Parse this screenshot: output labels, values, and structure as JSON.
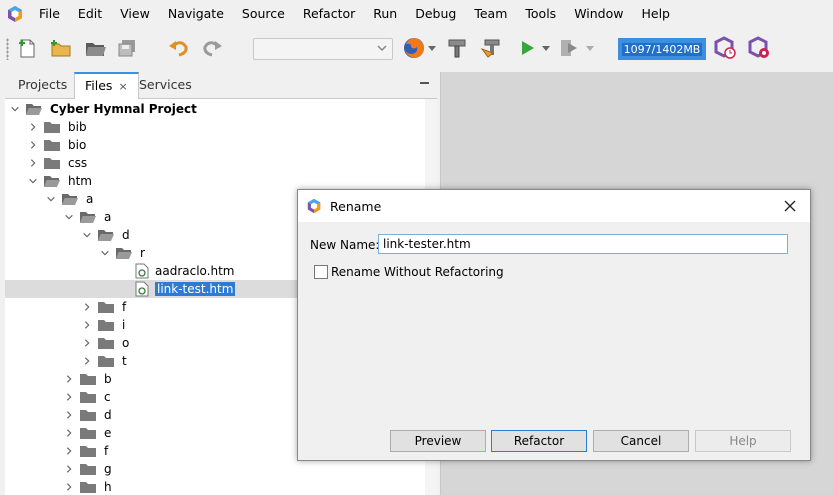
{
  "menu": [
    "File",
    "Edit",
    "View",
    "Navigate",
    "Source",
    "Refactor",
    "Run",
    "Debug",
    "Team",
    "Tools",
    "Window",
    "Help"
  ],
  "memory": {
    "label": "1097/1402MB"
  },
  "tabs": [
    {
      "label": "Projects"
    },
    {
      "label": "Files",
      "close": "×"
    },
    {
      "label": "Services"
    }
  ],
  "tree": [
    {
      "label": "Cyber Hymnal Project",
      "depth": 0,
      "expanded": true,
      "type": "root"
    },
    {
      "label": "bib",
      "depth": 1,
      "expanded": false,
      "type": "folder"
    },
    {
      "label": "bio",
      "depth": 1,
      "expanded": false,
      "type": "folder"
    },
    {
      "label": "css",
      "depth": 1,
      "expanded": false,
      "type": "folder"
    },
    {
      "label": "htm",
      "depth": 1,
      "expanded": true,
      "type": "folder"
    },
    {
      "label": "a",
      "depth": 2,
      "expanded": true,
      "type": "folder"
    },
    {
      "label": "a",
      "depth": 3,
      "expanded": true,
      "type": "folder"
    },
    {
      "label": "d",
      "depth": 4,
      "expanded": true,
      "type": "folder"
    },
    {
      "label": "r",
      "depth": 5,
      "expanded": true,
      "type": "folder"
    },
    {
      "label": "aadraclo.htm",
      "depth": 6,
      "type": "file"
    },
    {
      "label": "link-test.htm",
      "depth": 6,
      "type": "file",
      "selected": true
    },
    {
      "label": "f",
      "depth": 4,
      "expanded": false,
      "type": "folder"
    },
    {
      "label": "i",
      "depth": 4,
      "expanded": false,
      "type": "folder"
    },
    {
      "label": "o",
      "depth": 4,
      "expanded": false,
      "type": "folder"
    },
    {
      "label": "t",
      "depth": 4,
      "expanded": false,
      "type": "folder"
    },
    {
      "label": "b",
      "depth": 3,
      "expanded": false,
      "type": "folder"
    },
    {
      "label": "c",
      "depth": 3,
      "expanded": false,
      "type": "folder"
    },
    {
      "label": "d",
      "depth": 3,
      "expanded": false,
      "type": "folder"
    },
    {
      "label": "e",
      "depth": 3,
      "expanded": false,
      "type": "folder"
    },
    {
      "label": "f",
      "depth": 3,
      "expanded": false,
      "type": "folder"
    },
    {
      "label": "g",
      "depth": 3,
      "expanded": false,
      "type": "folder"
    },
    {
      "label": "h",
      "depth": 3,
      "expanded": false,
      "type": "folder"
    }
  ],
  "dialog": {
    "title": "Rename",
    "new_name_label": "New Name:",
    "new_name_value": "link-tester.htm",
    "checkbox_label": "Rename Without Refactoring",
    "buttons": {
      "preview": "Preview",
      "refactor": "Refactor",
      "cancel": "Cancel",
      "help": "Help"
    }
  },
  "colors": {
    "accent": "#3b8fde",
    "selection": "#2e7bd6"
  }
}
